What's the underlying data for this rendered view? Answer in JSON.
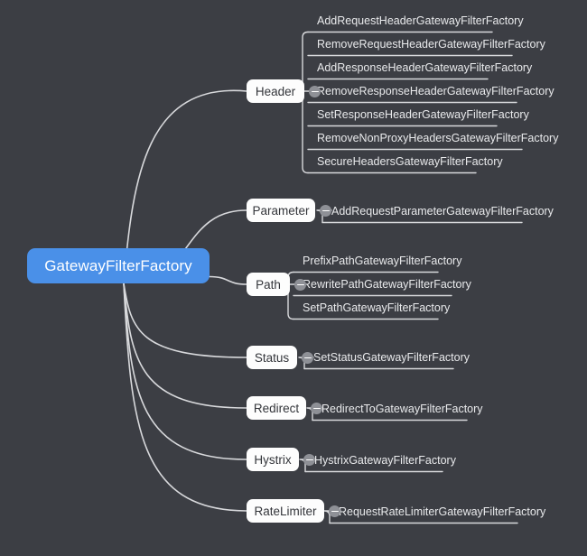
{
  "diagram": {
    "title": "GatewayFilterFactory",
    "background_color": "#3c3e44",
    "root_color": "#4a90e8",
    "node_color": "#fdfdfd",
    "line_color": "#d8d9dc",
    "toggle_icon": "collapse-minus-icon",
    "root": {
      "label": "GatewayFilterFactory"
    },
    "branches": [
      {
        "label": "Header",
        "leaves": [
          {
            "label": "AddRequestHeaderGatewayFilterFactory"
          },
          {
            "label": "RemoveRequestHeaderGatewayFilterFactory"
          },
          {
            "label": "AddResponseHeaderGatewayFilterFactory"
          },
          {
            "label": "RemoveResponseHeaderGatewayFilterFactory"
          },
          {
            "label": "SetResponseHeaderGatewayFilterFactory"
          },
          {
            "label": "RemoveNonProxyHeadersGatewayFilterFactory"
          },
          {
            "label": "SecureHeadersGatewayFilterFactory"
          }
        ]
      },
      {
        "label": "Parameter",
        "leaves": [
          {
            "label": "AddRequestParameterGatewayFilterFactory"
          }
        ]
      },
      {
        "label": "Path",
        "leaves": [
          {
            "label": "PrefixPathGatewayFilterFactory"
          },
          {
            "label": "RewritePathGatewayFilterFactory"
          },
          {
            "label": "SetPathGatewayFilterFactory"
          }
        ]
      },
      {
        "label": "Status",
        "leaves": [
          {
            "label": "SetStatusGatewayFilterFactory"
          }
        ]
      },
      {
        "label": "Redirect",
        "leaves": [
          {
            "label": "RedirectToGatewayFilterFactory"
          }
        ]
      },
      {
        "label": "Hystrix",
        "leaves": [
          {
            "label": "HystrixGatewayFilterFactory"
          }
        ]
      },
      {
        "label": "RateLimiter",
        "leaves": [
          {
            "label": "RequestRateLimiterGatewayFilterFactory"
          }
        ]
      }
    ]
  }
}
